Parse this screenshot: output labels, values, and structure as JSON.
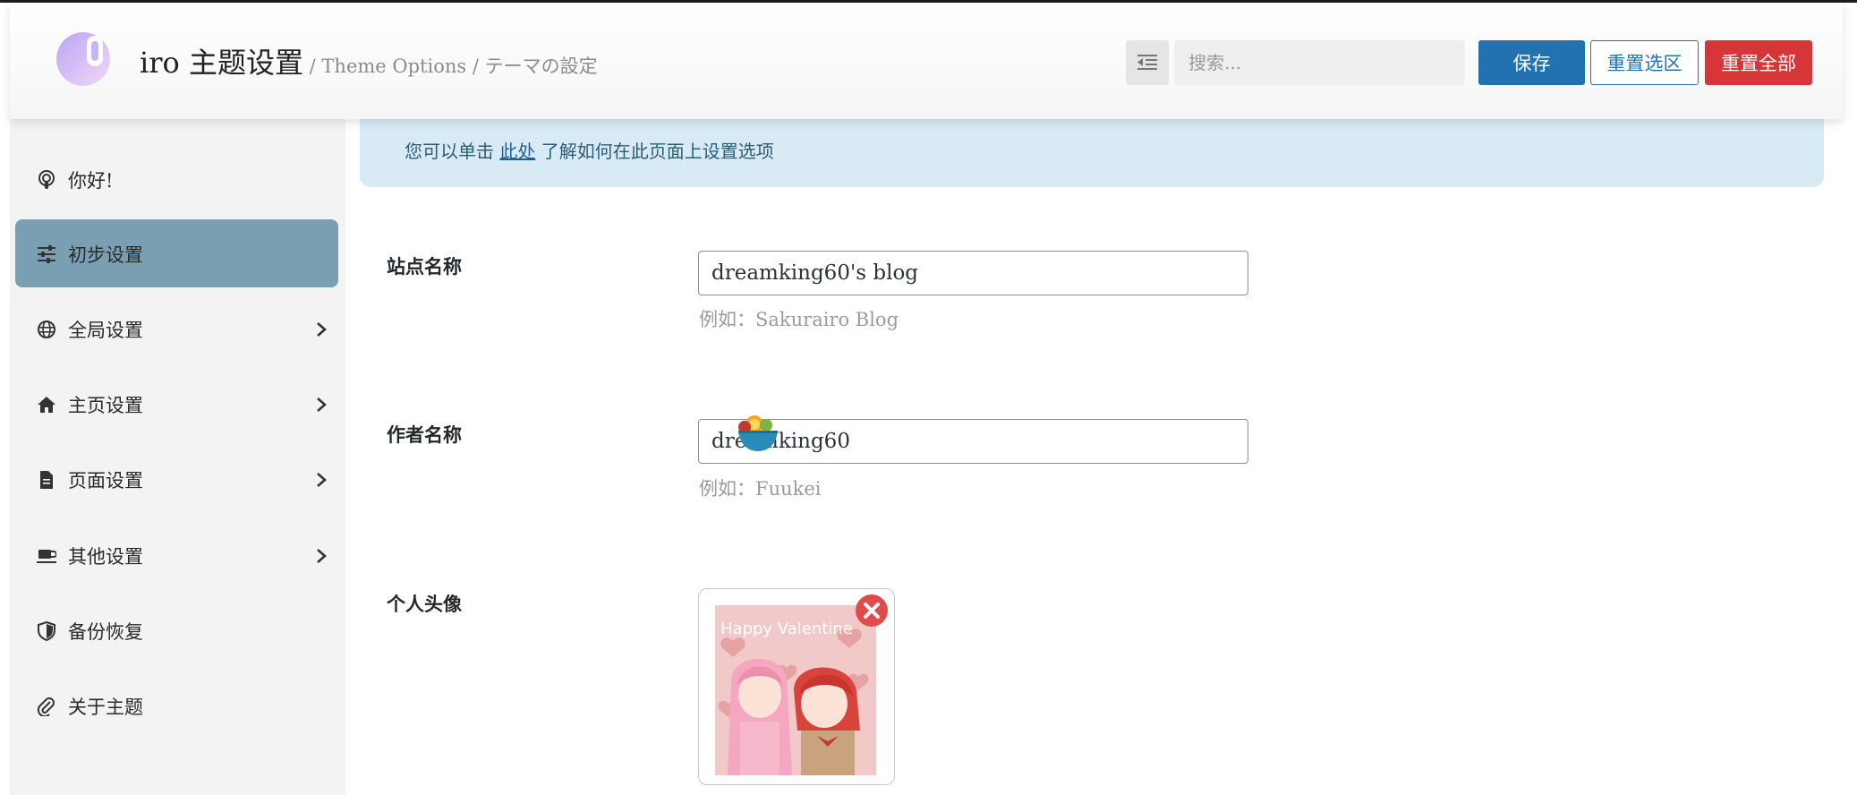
{
  "header": {
    "title": "iro 主题设置",
    "subtitle": " / Theme Options / テーマの設定",
    "logo_icon": "sakura-logo-icon",
    "search_placeholder": "搜索...",
    "save_label": "保存",
    "reset_section_label": "重置选区",
    "reset_all_label": "重置全部"
  },
  "sidebar": {
    "items": [
      {
        "label": "你好!",
        "icon": "podcast-icon",
        "active": false,
        "has_children": false
      },
      {
        "label": "初步设置",
        "icon": "sliders-icon",
        "active": true,
        "has_children": false
      },
      {
        "label": "全局设置",
        "icon": "globe-icon",
        "active": false,
        "has_children": true
      },
      {
        "label": "主页设置",
        "icon": "home-icon",
        "active": false,
        "has_children": true
      },
      {
        "label": "页面设置",
        "icon": "file-icon",
        "active": false,
        "has_children": true
      },
      {
        "label": "其他设置",
        "icon": "coffee-icon",
        "active": false,
        "has_children": true
      },
      {
        "label": "备份恢复",
        "icon": "shield-icon",
        "active": false,
        "has_children": false
      },
      {
        "label": "关于主题",
        "icon": "paperclip-icon",
        "active": false,
        "has_children": false
      }
    ]
  },
  "notice": {
    "before": "您可以单击 ",
    "link": "此处",
    "after": " 了解如何在此页面上设置选项"
  },
  "fields": {
    "site_name": {
      "label": "站点名称",
      "value": "dreamking60's blog",
      "hint": "例如：Sakurairo Blog"
    },
    "author_name": {
      "label": "作者名称",
      "value": "dreamking60",
      "hint": "例如：Fuukei"
    },
    "avatar": {
      "label": "个人头像",
      "image_text": "Happy Valentine"
    }
  },
  "colors": {
    "primary": "#2271b1",
    "danger": "#d63638",
    "active_nav": "#7a9fb3",
    "notice_bg": "#d8ebf5"
  }
}
